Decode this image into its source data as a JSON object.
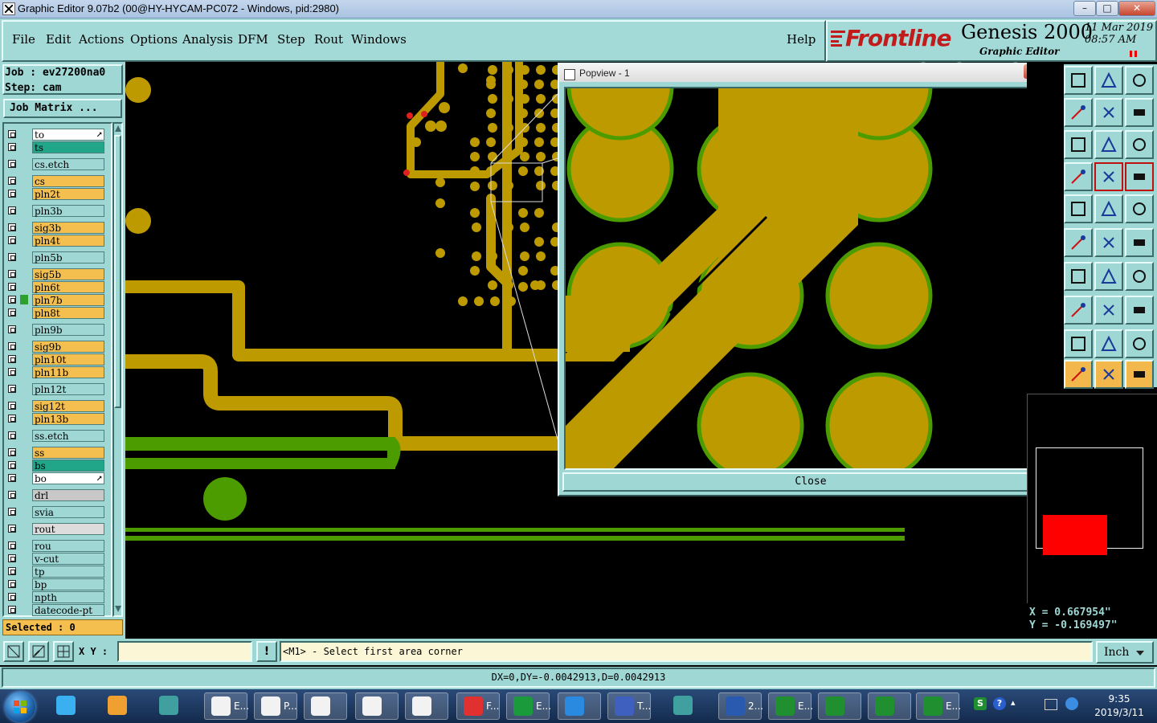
{
  "window": {
    "title": "Graphic Editor 9.07b2 (00@HY-HYCAM-PC072 - Windows, pid:2980)",
    "min": "–",
    "max": "□",
    "close": "✕"
  },
  "menu": {
    "items": [
      "File",
      "Edit",
      "Actions",
      "Options",
      "Analysis",
      "DFM",
      "Step",
      "Rout",
      "Windows"
    ],
    "help": "Help"
  },
  "brand": {
    "logo": "Frontline",
    "product": "Genesis 2000",
    "subtitle": "Graphic Editor",
    "date": "11 Mar 2019",
    "time": "08:57 AM"
  },
  "job": {
    "job_label": "Job : ev27200na0",
    "step_label": "Step: cam",
    "matrix_button": "Job Matrix ..."
  },
  "layers": [
    {
      "name": "to",
      "color": "#ffffff",
      "suffix": "⭧"
    },
    {
      "name": "ts",
      "color": "#22a68a"
    },
    {
      "name": "cs.etch",
      "color": "#9fd7d5"
    },
    {
      "name": "cs",
      "color": "#f5bf4f"
    },
    {
      "name": "pln2t",
      "color": "#f5bf4f"
    },
    {
      "name": "pln3b",
      "color": "#9fd7d5"
    },
    {
      "name": "sig3b",
      "color": "#f5bf4f"
    },
    {
      "name": "pln4t",
      "color": "#f5bf4f"
    },
    {
      "name": "pln5b",
      "color": "#9fd7d5"
    },
    {
      "name": "sig5b",
      "color": "#f5bf4f"
    },
    {
      "name": "pln6t",
      "color": "#f5bf4f"
    },
    {
      "name": "pln7b",
      "color": "#f5bf4f"
    },
    {
      "name": "pln8t",
      "color": "#f5bf4f"
    },
    {
      "name": "pln9b",
      "color": "#9fd7d5"
    },
    {
      "name": "sig9b",
      "color": "#f5bf4f"
    },
    {
      "name": "pln10t",
      "color": "#f5bf4f"
    },
    {
      "name": "pln11b",
      "color": "#f5bf4f"
    },
    {
      "name": "pln12t",
      "color": "#9fd7d5"
    },
    {
      "name": "sig12t",
      "color": "#f5bf4f"
    },
    {
      "name": "pln13b",
      "color": "#f5bf4f"
    },
    {
      "name": "ss.etch",
      "color": "#9fd7d5"
    },
    {
      "name": "ss",
      "color": "#f5bf4f"
    },
    {
      "name": "bs",
      "color": "#22a68a"
    },
    {
      "name": "bo",
      "color": "#ffffff",
      "suffix": "⭧"
    },
    {
      "name": "drl",
      "color": "#c8c8c8"
    },
    {
      "name": "svia",
      "color": "#9fd7d5"
    },
    {
      "name": "rout",
      "color": "#dcdcdc"
    },
    {
      "name": "rou",
      "color": "#9fd7d5"
    },
    {
      "name": "v-cut",
      "color": "#9fd7d5"
    },
    {
      "name": "tp",
      "color": "#9fd7d5"
    },
    {
      "name": "bp",
      "color": "#9fd7d5"
    },
    {
      "name": "npth",
      "color": "#9fd7d5"
    },
    {
      "name": "datecode-pt",
      "color": "#9fd7d5"
    }
  ],
  "selected": "Selected : 0",
  "popview": {
    "title": "Popview - 1",
    "close_label": "Close"
  },
  "coords": {
    "x": "X = 0.667954\"",
    "y": "Y = -0.169497\""
  },
  "command": {
    "xy_label": "X Y :",
    "input_value": "",
    "prompt": "<M1> - Select first area corner",
    "units": "Inch"
  },
  "status": {
    "text": "DX=0,DY=-0.0042913,D=0.0042913"
  },
  "taskbar": {
    "labels": [
      "E...",
      "P...",
      "",
      "",
      "",
      "F...",
      "E...",
      "",
      "T...",
      "",
      "2...",
      "E...",
      "",
      "",
      "E..."
    ],
    "time": "9:35",
    "date": "2019/3/11"
  },
  "colors": {
    "copper": "#bd9a00",
    "green": "#4c9c00",
    "panel": "#9fd7d5",
    "layer_orange": "#f5bf4f"
  }
}
